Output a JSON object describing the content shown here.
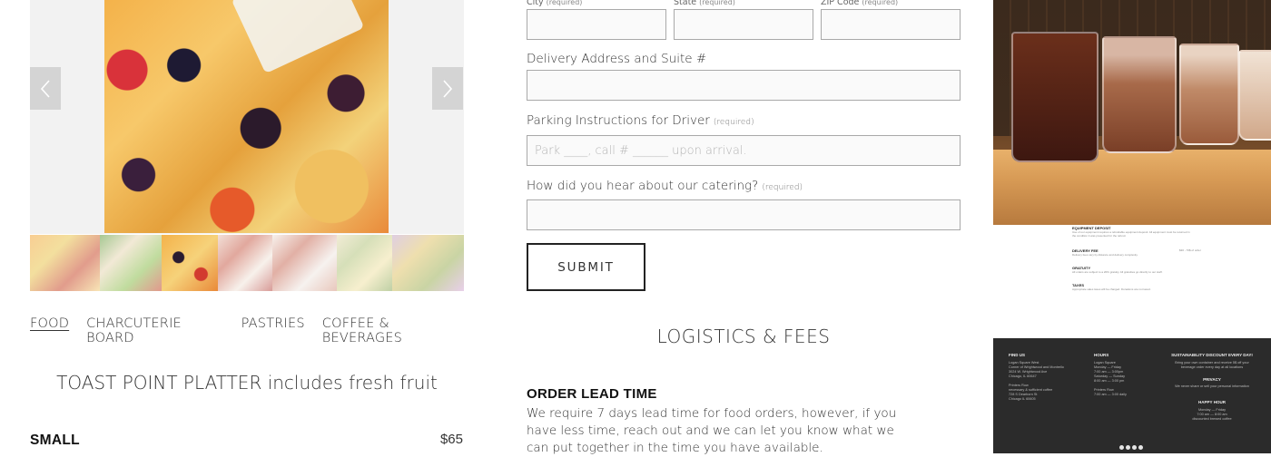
{
  "gallery": {
    "thumbnails": [
      {
        "name": "thumb-fruit-salad"
      },
      {
        "name": "thumb-green-salad"
      },
      {
        "name": "thumb-fruit-platter"
      },
      {
        "name": "thumb-charcuterie"
      },
      {
        "name": "thumb-sandwiches"
      },
      {
        "name": "thumb-quiche"
      },
      {
        "name": "thumb-grain-salad"
      }
    ]
  },
  "categories": [
    "FOOD",
    "CHARCUTERIE BOARD",
    "PASTRIES",
    "COFFEE & BEVERAGES"
  ],
  "active_category": "FOOD",
  "product": {
    "title": "TOAST POINT PLATTER includes fresh fruit",
    "size_label": "SMALL",
    "size_price": "$65"
  },
  "form": {
    "city_label": "City",
    "state_label": "State",
    "zip_label": "ZIP Code",
    "required_text": "(required)",
    "address_label": "Delivery Address and Suite #",
    "parking_label": "Parking Instructions for Driver",
    "parking_placeholder": "Park ____, call # ______ upon arrival.",
    "hear_label": "How did you hear about our catering?",
    "submit_label": "SUBMIT"
  },
  "logistics": {
    "title": "LOGISTICS & FEES",
    "lead_title": "ORDER LEAD TIME",
    "lead_body": "We require 7 days lead time for food orders, however, if you have less time, reach out and we can let you know what we can put together in the time you have available."
  },
  "mini_doc": {
    "sections": [
      {
        "title": "EQUIPMENT DEPOSIT",
        "desc": "Use of our equipment requires a refundable equipment deposit. All equipment must be returned in the condition it was presented for the refund.",
        "fee": ""
      },
      {
        "title": "DELIVERY FEE",
        "desc": "Delivery fees vary by distance and delivery complexity.",
        "fee": "$30 - 70$ of order"
      },
      {
        "title": "GRATUITY",
        "desc": "All orders are subject to a 20% gratuity. All gratuities go directly to our staff.",
        "fee": ""
      },
      {
        "title": "TAXES",
        "desc": "Appropriate sales taxes will be charged. Donations are not taxed.",
        "fee": ""
      }
    ]
  },
  "footer": {
    "find_us_title": "FIND US",
    "find_us_body": "Logan Square West\nCorner of Wrightwood and Montrello\n3024 W. Wrightwood Ave\nChicago, IL 60647\n\nPrinters Row\nnecessary & sufficient coffee\n728 S Dearborn St\nChicago IL 60605",
    "hours_title": "HOURS",
    "hours_body": "Logan Square\nMonday — Friday\n7:00 am — 3:00pm\nSaturday — Sunday\n8:00 am — 3:00 pm\n\nPrinters Row\n7:00 am — 3:00 daily",
    "discount_title": "SUSTAINABILITY DISCOUNT EVERY DAY!",
    "discount_body": "Bring your own container and receive 5$ off your\nbeverage order every day at all locations",
    "privacy_title": "PRIVACY",
    "privacy_body": "We never share or sell your personal information",
    "happy_title": "HAPPY HOUR",
    "happy_body": "Monday — Friday\n7:00 am — 8:00 am\ndiscounted brewed coffee"
  }
}
